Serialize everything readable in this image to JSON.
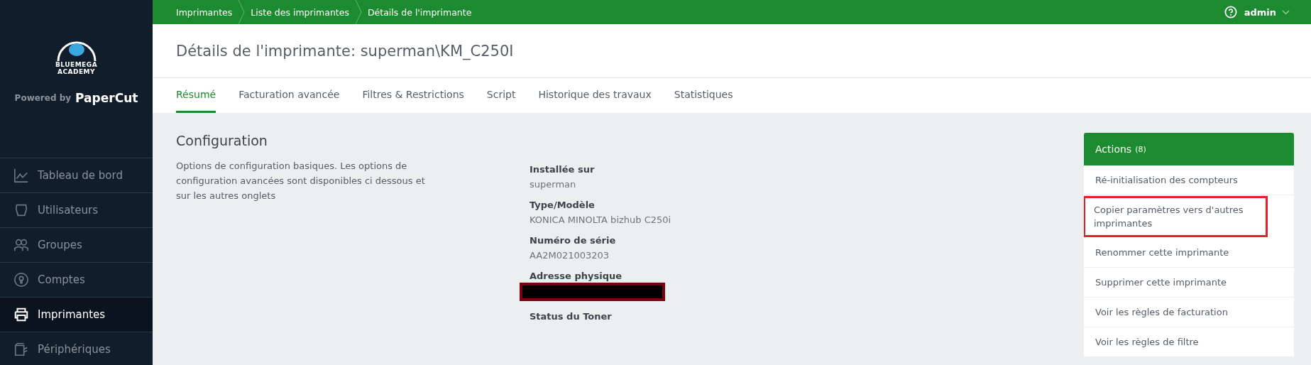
{
  "sidebar": {
    "brand": {
      "logo_line1": "BLUEMEGA",
      "logo_line2": "ACADEMY",
      "powered_by": "Powered by",
      "product": "PaperCut"
    },
    "items": [
      {
        "label": "Tableau de bord",
        "kind": "chart",
        "selected": false
      },
      {
        "label": "Utilisateurs",
        "kind": "user",
        "selected": false
      },
      {
        "label": "Groupes",
        "kind": "group",
        "selected": false
      },
      {
        "label": "Comptes",
        "kind": "account",
        "selected": false
      },
      {
        "label": "Imprimantes",
        "kind": "printer",
        "selected": true
      },
      {
        "label": "Périphériques",
        "kind": "device",
        "selected": false
      }
    ]
  },
  "breadcrumbs": [
    "Imprimantes",
    "Liste des imprimantes",
    "Détails de l'imprimante"
  ],
  "user": {
    "name": "admin"
  },
  "page_title": "Détails de l'imprimante: superman\\KM_C250I",
  "tabs": [
    {
      "label": "Résumé",
      "selected": true
    },
    {
      "label": "Facturation avancée",
      "selected": false
    },
    {
      "label": "Filtres & Restrictions",
      "selected": false
    },
    {
      "label": "Script",
      "selected": false
    },
    {
      "label": "Historique des travaux",
      "selected": false
    },
    {
      "label": "Statistiques",
      "selected": false
    }
  ],
  "section": {
    "title": "Configuration",
    "description": "Options de configuration basiques. Les options de configuration avancées sont disponibles ci dessous et sur les autres onglets",
    "fields": [
      {
        "label": "Installée sur",
        "value": "superman",
        "redacted": false
      },
      {
        "label": "Type/Modèle",
        "value": "KONICA MINOLTA bizhub C250i",
        "redacted": false
      },
      {
        "label": "Numéro de série",
        "value": "AA2M021003203",
        "redacted": false
      },
      {
        "label": "Adresse physique",
        "redacted": true
      },
      {
        "label": "Status du Toner",
        "redacted": false
      }
    ]
  },
  "actions": {
    "title": "Actions",
    "count": "(8)",
    "items": [
      {
        "label": "Ré-initialisation des compteurs",
        "highlighted": false
      },
      {
        "label": "Copier paramètres vers d'autres imprimantes",
        "highlighted": true
      },
      {
        "label": "Renommer cette imprimante",
        "highlighted": false
      },
      {
        "label": "Supprimer cette imprimante",
        "highlighted": false
      },
      {
        "label": "Voir les règles de facturation",
        "highlighted": false
      },
      {
        "label": "Voir les règles de filtre",
        "highlighted": false
      }
    ]
  }
}
